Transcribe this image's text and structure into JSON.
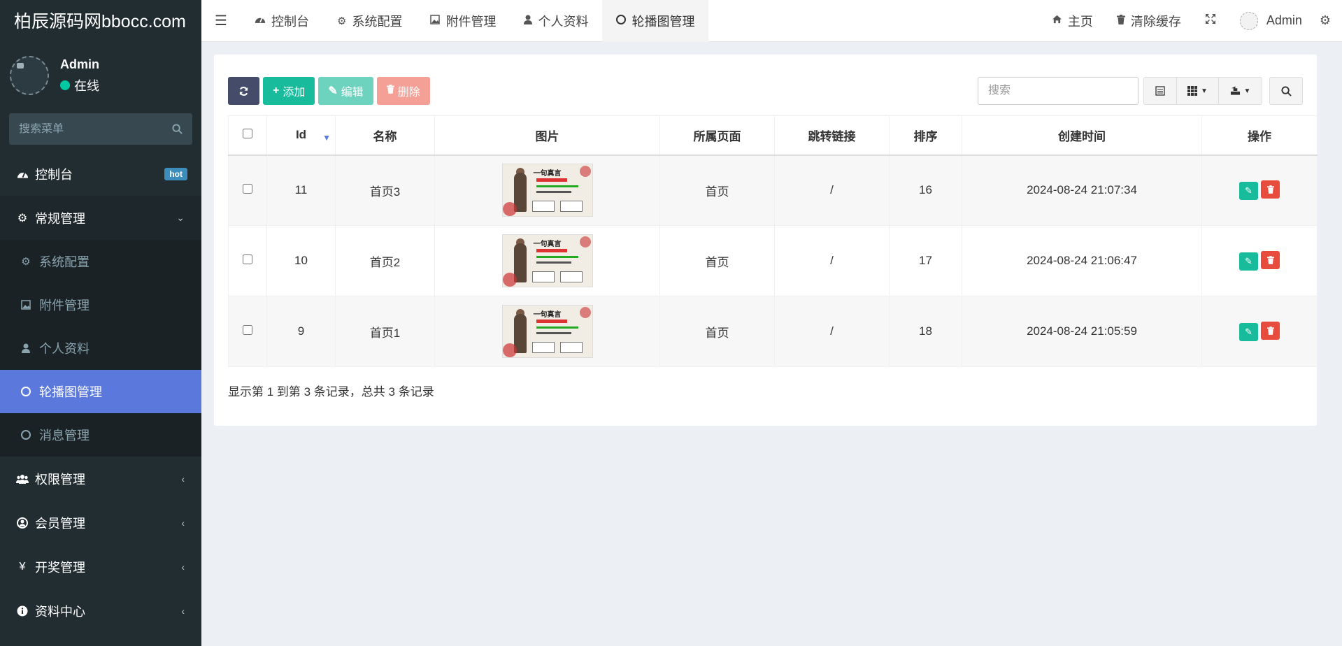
{
  "sidebar": {
    "logo": "柏辰源码网bbocc.com",
    "user_name": "Admin",
    "user_status": "在线",
    "search_placeholder": "搜索菜单",
    "items": [
      {
        "label": "控制台",
        "icon": "dashboard-icon",
        "badge": "hot"
      },
      {
        "label": "常规管理",
        "icon": "cogs-icon",
        "expanded": true
      },
      {
        "label": "权限管理",
        "icon": "group-icon"
      },
      {
        "label": "会员管理",
        "icon": "user-circle-icon"
      },
      {
        "label": "开奖管理",
        "icon": "yen-icon"
      },
      {
        "label": "资料中心",
        "icon": "info-circle-icon"
      }
    ],
    "subitems": [
      {
        "label": "系统配置",
        "icon": "cog-icon"
      },
      {
        "label": "附件管理",
        "icon": "image-icon"
      },
      {
        "label": "个人资料",
        "icon": "user-icon"
      },
      {
        "label": "轮播图管理",
        "icon": "circle-icon",
        "selected": true
      },
      {
        "label": "消息管理",
        "icon": "circle-icon"
      }
    ]
  },
  "topbar": {
    "tabs": [
      {
        "label": "控制台",
        "icon": "dashboard-icon"
      },
      {
        "label": "系统配置",
        "icon": "cog-icon"
      },
      {
        "label": "附件管理",
        "icon": "image-icon"
      },
      {
        "label": "个人资料",
        "icon": "user-icon"
      },
      {
        "label": "轮播图管理",
        "icon": "circle-icon",
        "active": true
      }
    ],
    "home_label": "主页",
    "clear_cache_label": "清除缓存",
    "admin_label": "Admin"
  },
  "toolbar": {
    "add_label": "添加",
    "edit_label": "编辑",
    "delete_label": "删除",
    "search_placeholder": "搜索"
  },
  "table": {
    "columns": [
      "Id",
      "名称",
      "图片",
      "所属页面",
      "跳转链接",
      "排序",
      "创建时间",
      "操作"
    ],
    "rows": [
      {
        "id": "11",
        "name": "首页3",
        "page": "首页",
        "link": "/",
        "sort": "16",
        "created": "2024-08-24 21:07:34"
      },
      {
        "id": "10",
        "name": "首页2",
        "page": "首页",
        "link": "/",
        "sort": "17",
        "created": "2024-08-24 21:06:47"
      },
      {
        "id": "9",
        "name": "首页1",
        "page": "首页",
        "link": "/",
        "sort": "18",
        "created": "2024-08-24 21:05:59"
      }
    ],
    "thumb_title": "一句真言"
  },
  "pagination": {
    "info": "显示第 1 到第 3 条记录，总共 3 条记录"
  },
  "colors": {
    "sidebar_bg": "#222d32",
    "selected_bg": "#5b78dc",
    "add_green": "#18bc9c",
    "delete_red": "#e74c3c",
    "online": "#00c8a0"
  }
}
